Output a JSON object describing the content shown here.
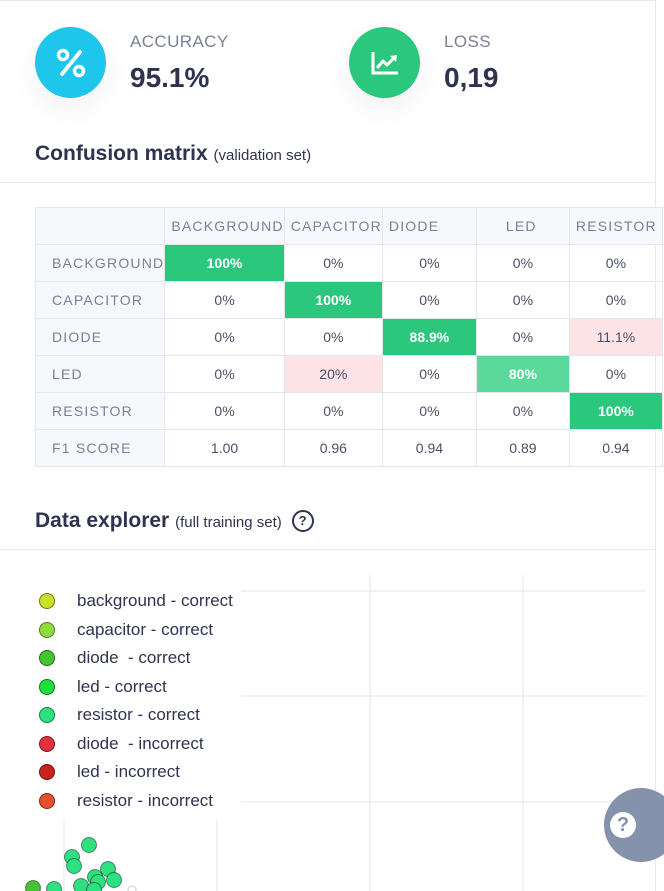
{
  "stats": {
    "accuracy": {
      "label": "ACCURACY",
      "value": "95.1%",
      "icon": "percent-icon",
      "color": "#1ec6ec"
    },
    "loss": {
      "label": "LOSS",
      "value": "0,19",
      "icon": "trending-up-icon",
      "color": "#2bc77c"
    }
  },
  "confusion": {
    "title": "Confusion matrix",
    "subtitle": "(validation set)",
    "columns": [
      "BACKGROUND",
      "CAPACITOR",
      "DIODE",
      "LED",
      "RESISTOR"
    ],
    "rows": [
      {
        "label": "BACKGROUND",
        "cells": [
          "100%",
          "0%",
          "0%",
          "0%",
          "0%"
        ]
      },
      {
        "label": "CAPACITOR",
        "cells": [
          "0%",
          "100%",
          "0%",
          "0%",
          "0%"
        ]
      },
      {
        "label": "DIODE",
        "cells": [
          "0%",
          "0%",
          "88.9%",
          "0%",
          "11.1%"
        ]
      },
      {
        "label": "LED",
        "cells": [
          "0%",
          "20%",
          "0%",
          "80%",
          "0%"
        ]
      },
      {
        "label": "RESISTOR",
        "cells": [
          "0%",
          "0%",
          "0%",
          "0%",
          "100%"
        ]
      }
    ],
    "f1": {
      "label": "F1 SCORE",
      "cells": [
        "1.00",
        "0.96",
        "0.94",
        "0.89",
        "0.94"
      ]
    }
  },
  "explorer": {
    "title": "Data explorer",
    "subtitle": "(full training set)",
    "help": "?",
    "legend": [
      {
        "label": "background - correct",
        "color": "#c8e02a"
      },
      {
        "label": "capacitor - correct",
        "color": "#8fdc3c"
      },
      {
        "label": "diode  - correct",
        "color": "#44c431"
      },
      {
        "label": "led - correct",
        "color": "#1fe03a"
      },
      {
        "label": "resistor - correct",
        "color": "#2ee07f"
      },
      {
        "label": "diode  - incorrect",
        "color": "#e0323c"
      },
      {
        "label": "led - incorrect",
        "color": "#c8231b"
      },
      {
        "label": "resistor - incorrect",
        "color": "#e5502a"
      }
    ]
  },
  "fab": {
    "label": "?"
  }
}
